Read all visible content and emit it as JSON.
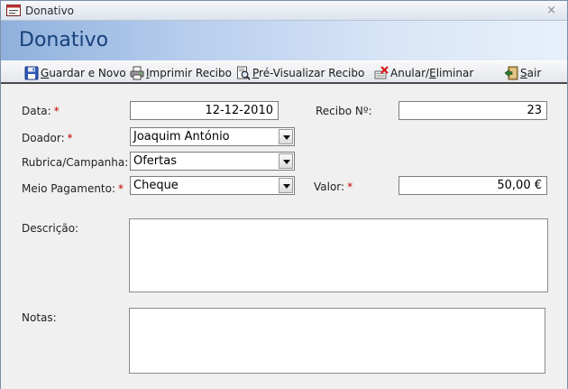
{
  "window": {
    "title": "Donativo",
    "close_glyph": "×"
  },
  "header": {
    "heading": "Donativo"
  },
  "toolbar": {
    "items": [
      {
        "label_pre": "",
        "accel": "G",
        "label_post": "uardar e Novo",
        "icon": "save-icon"
      },
      {
        "label_pre": "",
        "accel": "I",
        "label_post": "mprimir Recibo",
        "icon": "printer-icon"
      },
      {
        "label_pre": "",
        "accel": "P",
        "label_post": "ré-Visualizar Recibo",
        "icon": "print-preview-icon"
      },
      {
        "label_pre": "Anular/",
        "accel": "E",
        "label_post": "liminar",
        "icon": "delete-icon"
      },
      {
        "label_pre": "",
        "accel": "S",
        "label_post": "air",
        "icon": "exit-icon"
      }
    ]
  },
  "form": {
    "data": {
      "label": "Data:",
      "required": "*",
      "value": "12-12-2010"
    },
    "recibo": {
      "label": "Recibo Nº:",
      "value": "23"
    },
    "doador": {
      "label": "Doador:",
      "required": "*",
      "value": "Joaquim António"
    },
    "rubrica": {
      "label": "Rubrica/Campanha:",
      "value": "Ofertas"
    },
    "meio": {
      "label": "Meio Pagamento:",
      "required": "*",
      "value": "Cheque"
    },
    "valor": {
      "label": "Valor:",
      "required": "*",
      "value": "50,00 €"
    },
    "descricao": {
      "label": "Descrição:",
      "value": ""
    },
    "notas": {
      "label": "Notas:",
      "value": ""
    }
  },
  "colors": {
    "heading": "#16407a",
    "required": "#c00000",
    "header_gradient_start": "#8fb0dc",
    "header_gradient_end": "#e8f0fa"
  }
}
